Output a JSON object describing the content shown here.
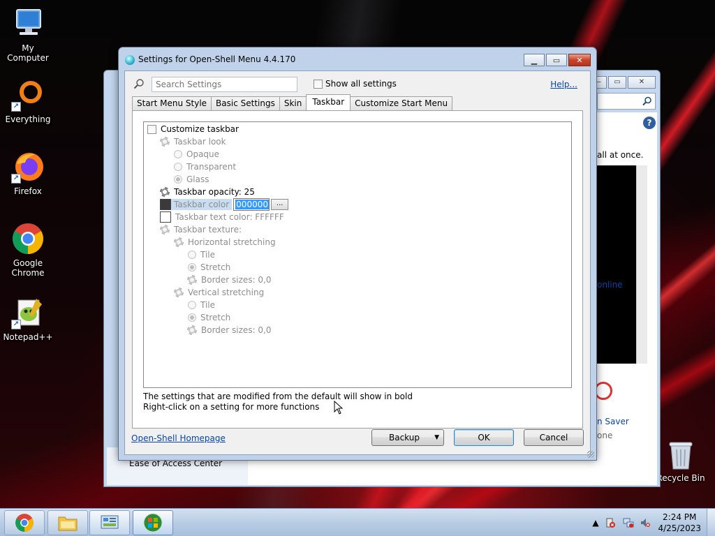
{
  "desktop": {
    "icons": [
      {
        "label": "My Computer"
      },
      {
        "label": "Everything"
      },
      {
        "label": "Firefox"
      },
      {
        "label": "Google Chrome"
      },
      {
        "label": "Notepad++"
      },
      {
        "label": "Recycle Bin"
      }
    ]
  },
  "back_window": {
    "text_all_at_once": "all at once.",
    "text_online": "online",
    "text_saver": "n Saver",
    "text_one": "one",
    "text_ease": "Ease of Access Center"
  },
  "dialog": {
    "title": "Settings for Open-Shell Menu 4.4.170",
    "search_placeholder": "Search Settings",
    "show_all_label": "Show all settings",
    "help_label": "Help...",
    "tabs": [
      {
        "label": "Start Menu Style"
      },
      {
        "label": "Basic Settings"
      },
      {
        "label": "Skin"
      },
      {
        "label": "Taskbar"
      },
      {
        "label": "Customize Start Menu"
      }
    ],
    "settings": {
      "customize_taskbar": "Customize taskbar",
      "taskbar_look": "Taskbar look",
      "opaque": "Opaque",
      "transparent": "Transparent",
      "glass": "Glass",
      "taskbar_opacity": "Taskbar opacity: 25",
      "taskbar_color": "Taskbar color",
      "taskbar_color_value": "000000",
      "dots": "...",
      "taskbar_text_color": "Taskbar text color: FFFFFF",
      "taskbar_texture": "Taskbar texture:",
      "horizontal_stretching": "Horizontal stretching",
      "h_tile": "Tile",
      "h_stretch": "Stretch",
      "h_border": "Border sizes: 0,0",
      "vertical_stretching": "Vertical stretching",
      "v_tile": "Tile",
      "v_stretch": "Stretch",
      "v_border": "Border sizes: 0,0"
    },
    "hint_line1": "The settings that are modified from the default will show in bold",
    "hint_line2": "Right-click on a setting for more functions",
    "homepage_link": "Open-Shell Homepage",
    "backup_label": "Backup",
    "ok_label": "OK",
    "cancel_label": "Cancel"
  },
  "taskbar": {
    "time": "2:24 PM",
    "date": "4/25/2023"
  },
  "colors": {
    "taskbar_color_swatch": "#3a3a3a",
    "text_color_swatch": "#ffffff",
    "accent_selection": "#3399ff",
    "link": "#0645ad"
  }
}
